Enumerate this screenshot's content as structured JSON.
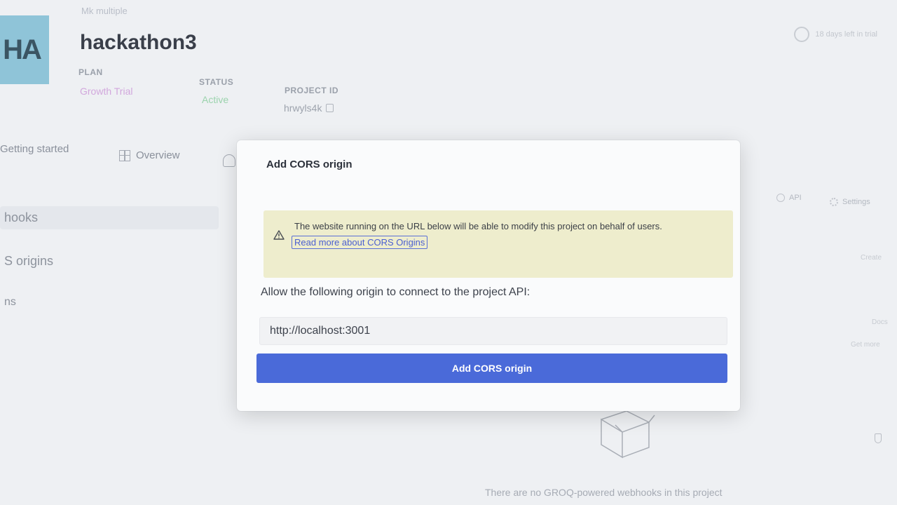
{
  "header": {
    "org_name": "Mk multiple",
    "avatar_initials": "HA",
    "project_title": "hackathon3",
    "plan_label": "PLAN",
    "plan_value": "Growth Trial",
    "status_label": "STATUS",
    "status_value": "Active",
    "project_id_label": "PROJECT ID",
    "project_id_value": "hrwyls4k",
    "trial_text": "18 days left in trial"
  },
  "tabs": [
    {
      "label": "Getting started"
    },
    {
      "label": "Overview"
    },
    {
      "label": "API"
    },
    {
      "label": "Settings"
    }
  ],
  "sidebar": {
    "items": [
      {
        "label": "hooks"
      },
      {
        "label": "S origins"
      },
      {
        "label": "ns"
      }
    ]
  },
  "right_snippets": [
    "Create",
    "Docs",
    "Get more"
  ],
  "modal": {
    "title": "Add CORS origin",
    "warning_text": "The website running on the URL below will be able to modify this project on behalf of users.",
    "warning_link": "Read more about CORS Origins",
    "field_label": "Allow the following origin to connect to the project API:",
    "origin_value": "http://localhost:3001",
    "submit_label": "Add CORS origin"
  },
  "empty_state": {
    "text": "There are no GROQ-powered webhooks in this project"
  },
  "colors": {
    "accent": "#4a6ad9",
    "warning_bg": "#eeedcd",
    "status_active": "#9bd3ad",
    "plan_badge": "#d2a8dd"
  }
}
